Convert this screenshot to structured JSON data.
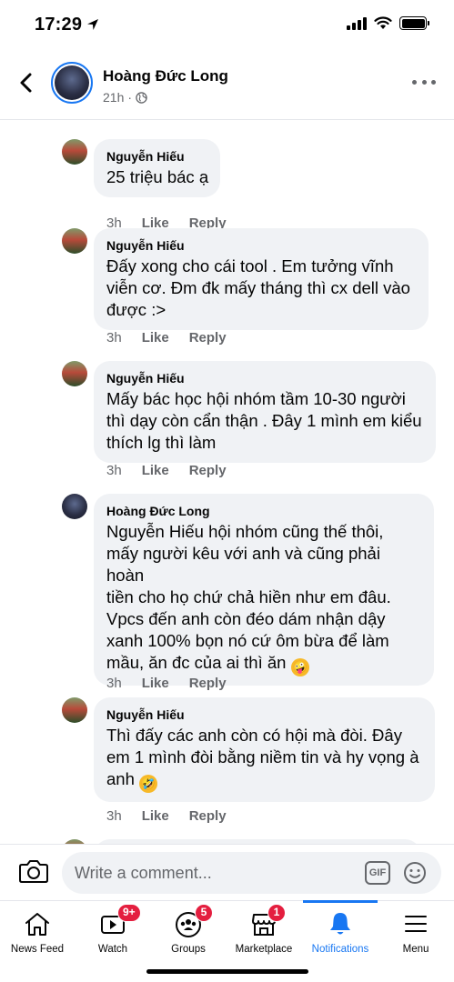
{
  "status_bar": {
    "time": "17:29"
  },
  "header": {
    "name": "Hoàng Đức Long",
    "time": "21h",
    "separator": "·"
  },
  "comments": [
    {
      "author": "Nguyễn Hiếu",
      "text": "25 triệu bác ạ",
      "time": "3h",
      "like": "Like",
      "reply": "Reply"
    },
    {
      "author": "Nguyễn Hiếu",
      "text": "Đấy xong cho cái tool . Em tưởng vĩnh\nviễn cơ. Đm đk mấy tháng thì cx dell vào\nđược :>",
      "time": "3h",
      "like": "Like",
      "reply": "Reply"
    },
    {
      "author": "Nguyễn Hiếu",
      "text": "Mấy bác học hội nhóm tầm 10-30 người\nthì dạy còn cẩn thận . Đây 1 mình em kiểu\nthích lg thì làm",
      "time": "3h",
      "like": "Like",
      "reply": "Reply"
    },
    {
      "author": "Hoàng Đức Long",
      "text": "Nguyễn Hiếu  hội nhóm cũng thế thôi,\nmấy người kêu với anh và cũng phải hoàn\ntiền cho họ chứ chả hiền như em đâu.\nVpcs đến anh còn đéo dám nhận dậy\nxanh 100% bọn nó cứ ôm bừa để làm\nmầu, ăn đc của ai thì ăn",
      "emoji": "🤪",
      "time": "3h",
      "like": "Like",
      "reply": "Reply"
    },
    {
      "author": "Nguyễn Hiếu",
      "text": "Thì đấy các anh còn có hội mà đòi. Đây\nem 1 mình đòi bằng niềm tin và hy vọng à\nanh",
      "emoji": "🤣",
      "time": "3h",
      "like": "Like",
      "reply": "Reply"
    }
  ],
  "composer": {
    "placeholder": "Write a comment...",
    "gif_label": "GIF"
  },
  "bottom_nav": {
    "items": [
      {
        "label": "News Feed",
        "icon": "home-icon"
      },
      {
        "label": "Watch",
        "icon": "watch-icon",
        "badge": "9+"
      },
      {
        "label": "Groups",
        "icon": "groups-icon",
        "badge": "5"
      },
      {
        "label": "Marketplace",
        "icon": "marketplace-icon",
        "badge": "1"
      },
      {
        "label": "Notifications",
        "icon": "bell-icon",
        "active": true
      },
      {
        "label": "Menu",
        "icon": "menu-icon"
      }
    ]
  },
  "colors": {
    "accent": "#1877f2",
    "bubble": "#f0f2f5",
    "secondary_text": "#65676b",
    "badge": "#e41e3f"
  }
}
